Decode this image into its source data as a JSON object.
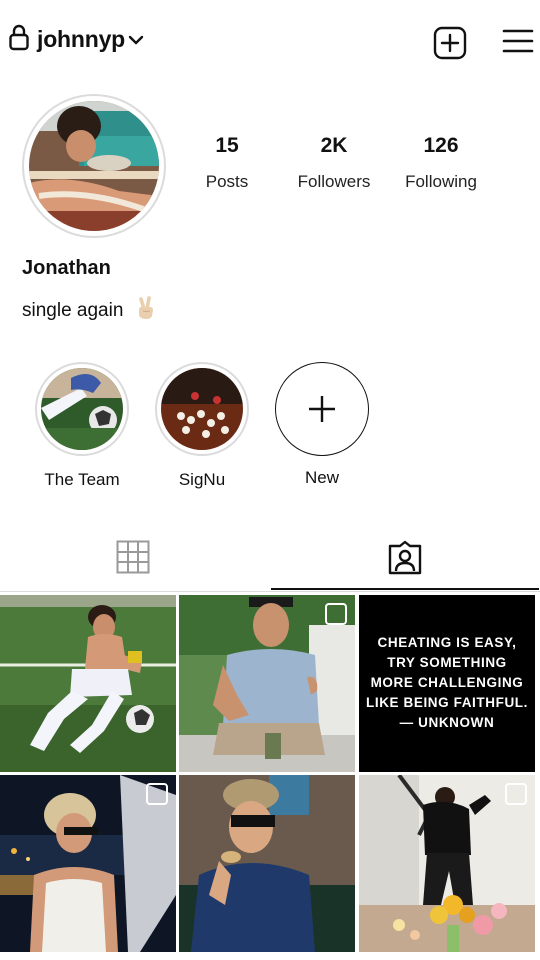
{
  "header": {
    "username": "johnnyp",
    "icons": [
      "lock-icon",
      "chevron-down-icon",
      "new-post-icon",
      "menu-icon"
    ]
  },
  "profile": {
    "posts_count": "15",
    "posts_label": "Posts",
    "followers_count": "2K",
    "followers_label": "Followers",
    "following_count": "126",
    "following_label": "Following",
    "full_name": "Jonathan",
    "bio": "single again"
  },
  "highlights": [
    {
      "label": "The Team"
    },
    {
      "label": "SigNu"
    },
    {
      "label": "New"
    }
  ],
  "tabs": [
    {
      "icon": "grid-icon",
      "active": false
    },
    {
      "icon": "tagged-icon",
      "active": true
    }
  ],
  "posts": [
    {
      "type": "photo"
    },
    {
      "type": "photo",
      "multiple": true
    },
    {
      "type": "quote",
      "lines": [
        "CHEATING IS EASY,",
        "TRY SOMETHING",
        "MORE CHALLENGING",
        "LIKE BEING FAITHFUL.",
        "— UNKNOWN"
      ]
    },
    {
      "type": "photo",
      "multiple": true
    },
    {
      "type": "photo"
    },
    {
      "type": "photo",
      "multiple": true
    }
  ],
  "colors": {
    "text": "#111111",
    "border": "#dbdbdb",
    "quote_bg": "#000000"
  }
}
